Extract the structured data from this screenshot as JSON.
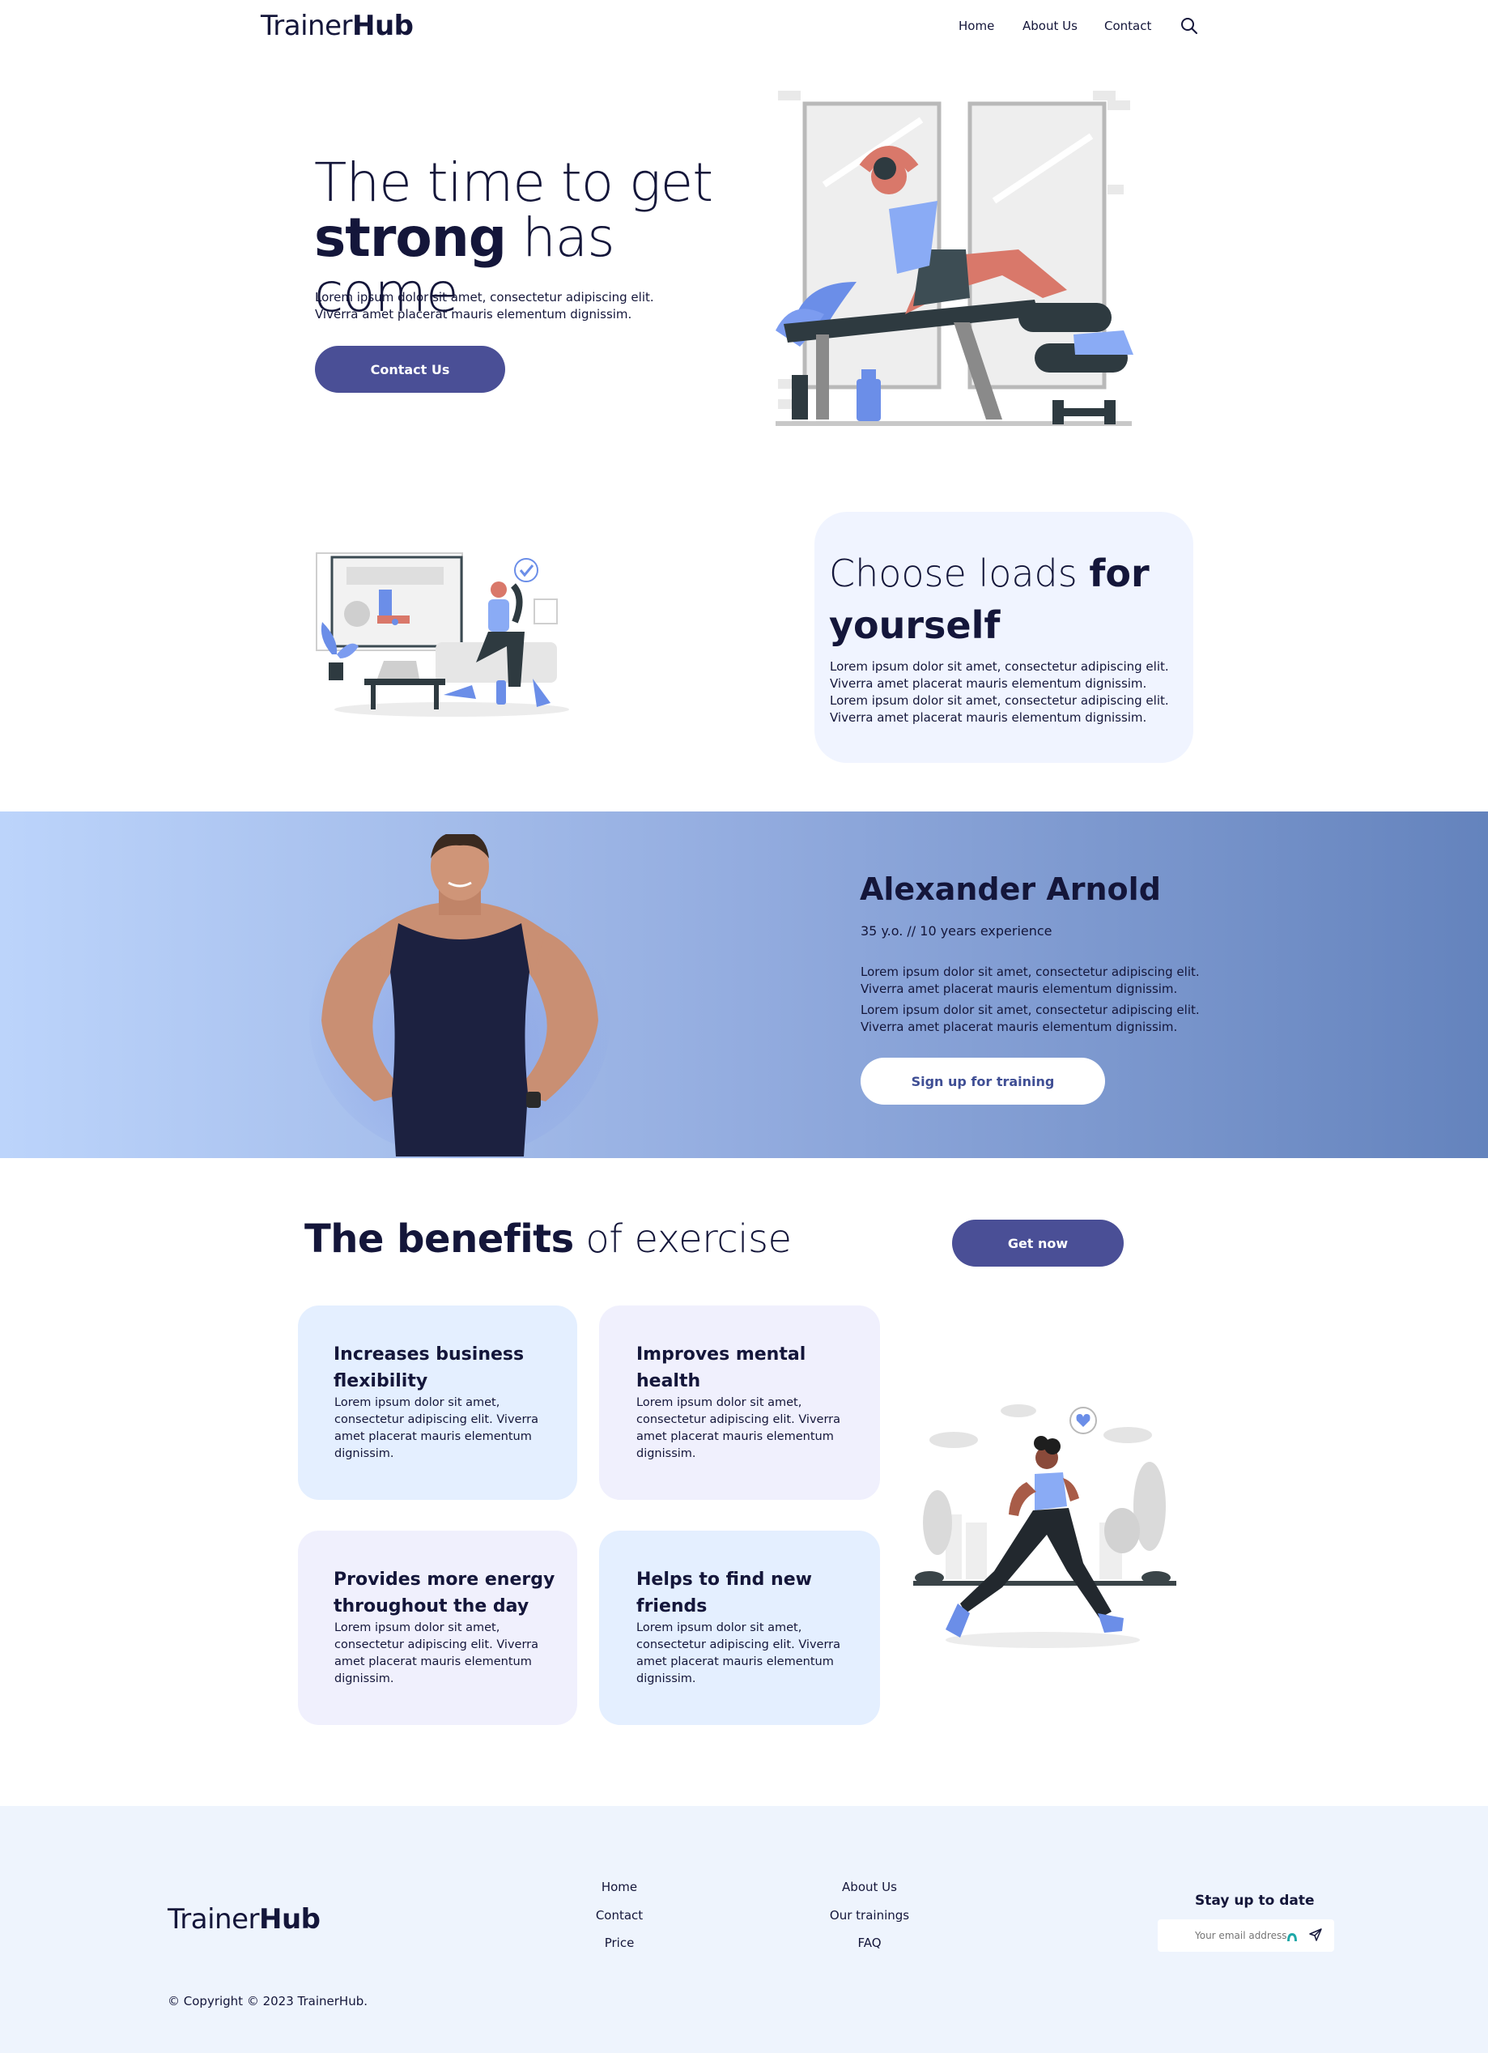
{
  "header": {
    "logo_light": "Trainer",
    "logo_bold": "Hub",
    "nav": [
      "Home",
      "About Us",
      "Contact"
    ],
    "search_icon": "search-icon"
  },
  "hero": {
    "title_line1": "The time to get",
    "title_bold": "strong",
    "title_line2_rest": " has come",
    "text_line1": "Lorem ipsum dolor sit amet, consectetur adipiscing elit.",
    "text_line2": "Viverra amet placerat mauris elementum dignissim.",
    "cta": "Contact Us"
  },
  "loads": {
    "title_light": "Choose loads ",
    "title_bold_1": "for",
    "title_bold_2": "yourself",
    "lines": [
      "Lorem ipsum dolor sit amet, consectetur adipiscing elit.",
      "Viverra amet placerat mauris elementum dignissim.",
      "Lorem ipsum dolor sit amet, consectetur adipiscing elit.",
      "Viverra amet placerat mauris elementum dignissim."
    ]
  },
  "trainer": {
    "name": "Alexander Arnold",
    "meta": "35 y.o. // 10 years experience",
    "lines": [
      "Lorem ipsum dolor sit amet, consectetur adipiscing elit.",
      "Viverra amet placerat mauris elementum dignissim.",
      "Lorem ipsum dolor sit amet, consectetur adipiscing elit.",
      "Viverra amet placerat mauris elementum dignissim."
    ],
    "cta": "Sign up for training"
  },
  "benefits": {
    "title_bold": "The benefits",
    "title_light": " of exercise",
    "cta": "Get now",
    "cards": [
      {
        "title": [
          "Increases business",
          "flexibility"
        ],
        "text": [
          "Lorem ipsum dolor sit amet,",
          "consectetur adipiscing elit. Viverra",
          "amet placerat mauris elementum",
          "dignissim."
        ]
      },
      {
        "title": [
          "Improves mental",
          "health"
        ],
        "text": [
          "Lorem ipsum dolor sit amet,",
          "consectetur adipiscing elit. Viverra",
          "amet placerat mauris elementum",
          "dignissim."
        ]
      },
      {
        "title": [
          "Provides more energy",
          "throughout the day"
        ],
        "text": [
          "Lorem ipsum dolor sit amet,",
          "consectetur adipiscing elit. Viverra",
          "amet placerat mauris elementum",
          "dignissim."
        ]
      },
      {
        "title": [
          "Helps to find new",
          "friends"
        ],
        "text": [
          "Lorem ipsum dolor sit amet,",
          "consectetur adipiscing elit. Viverra",
          "amet placerat mauris elementum",
          "dignissim."
        ]
      }
    ]
  },
  "footer": {
    "logo_light": "Trainer",
    "logo_bold": "Hub",
    "col1": [
      "Home",
      "Contact",
      "Price"
    ],
    "col2": [
      "About Us",
      "Our trainings",
      "FAQ"
    ],
    "newsletter_title": "Stay up to date",
    "email_placeholder": "Your email address",
    "copyright": "© Copyright © 2023 TrainerHub."
  },
  "colors": {
    "primary_button": "#4a4f96",
    "dark_text": "#14163a",
    "loads_card": "#f0f4ff",
    "footer_bg": "#eef4fd"
  }
}
